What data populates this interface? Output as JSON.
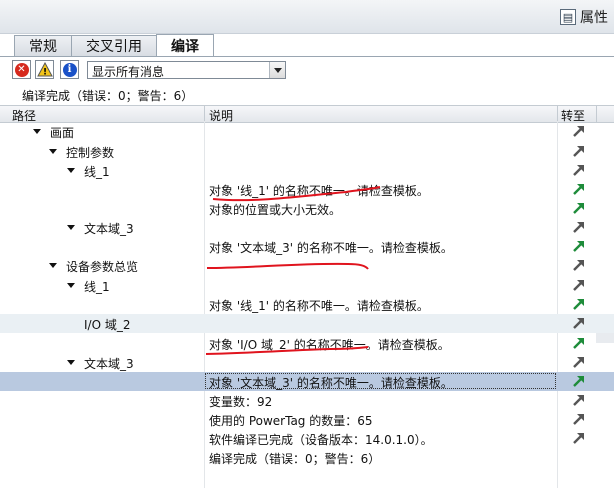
{
  "header": {
    "properties_label": "属性"
  },
  "tabs": [
    {
      "label": "常规",
      "active": false
    },
    {
      "label": "交叉引用",
      "active": false
    },
    {
      "label": "编译",
      "active": true
    }
  ],
  "toolbar": {
    "filter_value": "显示所有消息"
  },
  "summary": "编译完成（错误：0；警告：6）",
  "columns": {
    "path": "路径",
    "description": "说明",
    "goto": "转至"
  },
  "rows": [
    {
      "path": "画面",
      "desc": "",
      "goto": "gray",
      "expander": true
    },
    {
      "path": "控制参数",
      "desc": "",
      "goto": "gray",
      "expander": true
    },
    {
      "path": "线_1",
      "desc": "",
      "goto": "gray",
      "expander": true
    },
    {
      "path": "",
      "desc": "对象 '线_1' 的名称不唯一。请检查模板。",
      "goto": "green"
    },
    {
      "path": "",
      "desc": "对象的位置或大小无效。",
      "goto": "green"
    },
    {
      "path": "文本域_3",
      "desc": "",
      "goto": "gray",
      "expander": true
    },
    {
      "path": "",
      "desc": "对象 '文本域_3' 的名称不唯一。请检查模板。",
      "goto": "green"
    },
    {
      "path": "设备参数总览",
      "desc": "",
      "goto": "gray",
      "expander": true
    },
    {
      "path": "线_1",
      "desc": "",
      "goto": "gray",
      "expander": true
    },
    {
      "path": "",
      "desc": "对象 '线_1' 的名称不唯一。请检查模板。",
      "goto": "green"
    },
    {
      "path": "I/O 域_2",
      "desc": "",
      "goto": "gray",
      "expander": false
    },
    {
      "path": "",
      "desc": "对象 'I/O 域_2' 的名称不唯一。请检查模板。",
      "goto": "green"
    },
    {
      "path": "文本域_3",
      "desc": "",
      "goto": "gray",
      "expander": true
    },
    {
      "path": "",
      "desc": "对象 '文本域_3' 的名称不唯一。请检查模板。",
      "goto": "green"
    },
    {
      "path": "",
      "desc": "变量数：92",
      "goto": "gray"
    },
    {
      "path": "",
      "desc": "使用的 PowerTag 的数量：65",
      "goto": "gray"
    },
    {
      "path": "",
      "desc": "软件编译已完成（设备版本：14.0.1.0）。",
      "goto": "gray"
    },
    {
      "path": "",
      "desc": "编译完成（错误：0；警告：6）",
      "goto": "none"
    }
  ],
  "colors": {
    "selection": "#b9c9e0",
    "alt_row": "#eaf0f4",
    "goto_green": "#1e8c3a",
    "goto_gray": "#555555",
    "annotation_red": "#e0141e"
  },
  "icons": [
    "properties-icon",
    "error-filter-icon",
    "warning-filter-icon",
    "info-filter-icon",
    "dropdown-arrow-icon",
    "expand-triangle-icon",
    "goto-arrow-icon"
  ]
}
